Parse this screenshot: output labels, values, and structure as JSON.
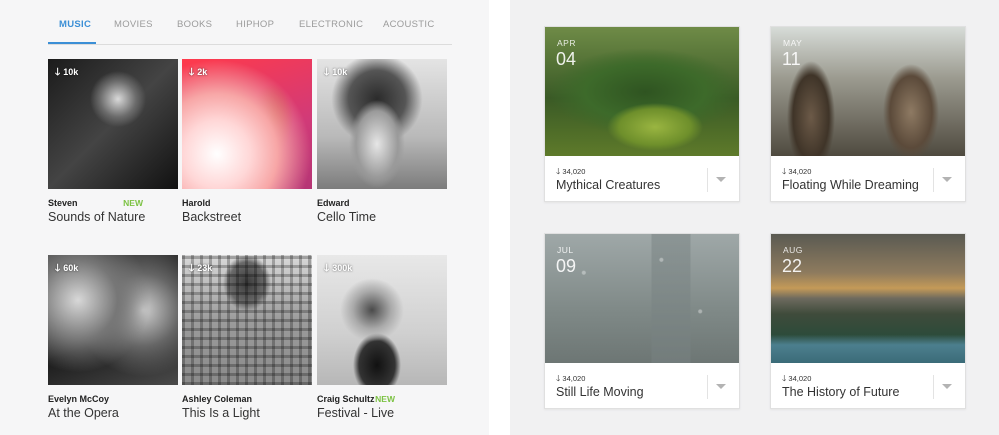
{
  "music_panel": {
    "tabs": [
      {
        "label": "MUSIC",
        "active": true
      },
      {
        "label": "MOVIES",
        "active": false
      },
      {
        "label": "BOOKS",
        "active": false
      },
      {
        "label": "HIPHOP",
        "active": false
      },
      {
        "label": "ELECTRONIC",
        "active": false
      },
      {
        "label": "ACOUSTIC",
        "active": false
      }
    ],
    "accent_color": "#3b8fd6",
    "new_badge_color": "#7cc243",
    "tiles": [
      {
        "downloads": "10k",
        "artist": "Steven",
        "new": "NEW",
        "title": "Sounds of Nature",
        "download_icon": "download-arrow-icon"
      },
      {
        "downloads": "2k",
        "artist": "Harold",
        "new": "",
        "title": "Backstreet",
        "download_icon": "download-arrow-icon"
      },
      {
        "downloads": "10k",
        "artist": "Edward",
        "new": "",
        "title": "Cello Time",
        "download_icon": "download-arrow-icon"
      },
      {
        "downloads": "60k",
        "artist": "Evelyn McCoy",
        "new": "",
        "title": "At the Opera",
        "download_icon": "download-arrow-icon"
      },
      {
        "downloads": "23k",
        "artist": "Ashley Coleman",
        "new": "",
        "title": "This Is a Light",
        "download_icon": "download-arrow-icon"
      },
      {
        "downloads": "300k",
        "artist": "Craig Schultz",
        "new": "NEW",
        "title": "Festival - Live",
        "download_icon": "download-arrow-icon"
      }
    ]
  },
  "cards_panel": {
    "cards": [
      {
        "month": "APR",
        "day": "04",
        "stats": "34,020",
        "title": "Mythical Creatures",
        "menu_icon": "caret-down-icon"
      },
      {
        "month": "MAY",
        "day": "11",
        "stats": "34,020",
        "title": "Floating While Dreaming",
        "menu_icon": "caret-down-icon"
      },
      {
        "month": "JUL",
        "day": "09",
        "stats": "34,020",
        "title": "Still Life Moving",
        "menu_icon": "caret-down-icon"
      },
      {
        "month": "AUG",
        "day": "22",
        "stats": "34,020",
        "title": "The History of Future",
        "menu_icon": "caret-down-icon"
      }
    ]
  }
}
